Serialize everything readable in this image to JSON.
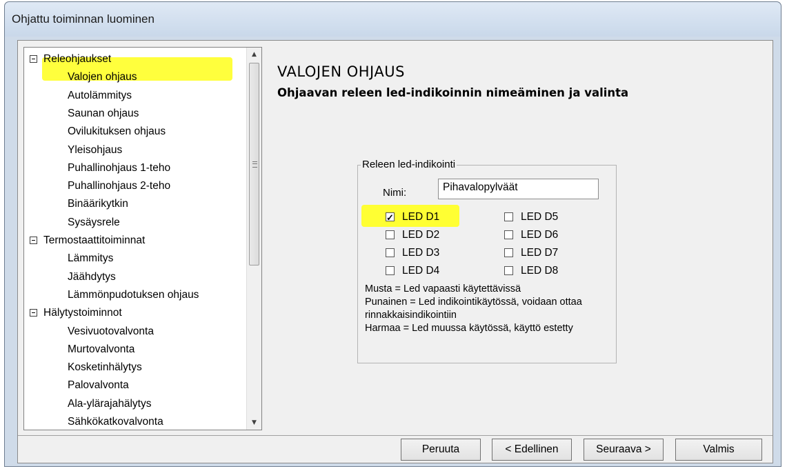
{
  "window": {
    "title": "Ohjattu toiminnan luominen"
  },
  "tree": {
    "items": [
      {
        "label": "Releohjaukset",
        "level": 0,
        "expanded": true
      },
      {
        "label": "Valojen ohjaus",
        "level": 1,
        "selected": true
      },
      {
        "label": "Autolämmitys",
        "level": 1
      },
      {
        "label": "Saunan ohjaus",
        "level": 1
      },
      {
        "label": "Ovilukituksen ohjaus",
        "level": 1
      },
      {
        "label": "Yleisohjaus",
        "level": 1
      },
      {
        "label": "Puhallinohjaus 1-teho",
        "level": 1
      },
      {
        "label": "Puhallinohjaus 2-teho",
        "level": 1
      },
      {
        "label": "Binäärikytkin",
        "level": 1
      },
      {
        "label": "Sysäysrele",
        "level": 1
      },
      {
        "label": "Termostaattitoiminnat",
        "level": 0,
        "expanded": true
      },
      {
        "label": "Lämmitys",
        "level": 1
      },
      {
        "label": "Jäähdytys",
        "level": 1
      },
      {
        "label": "Lämmönpudotuksen ohjaus",
        "level": 1
      },
      {
        "label": "Hälytystoiminnot",
        "level": 0,
        "expanded": true
      },
      {
        "label": "Vesivuotovalvonta",
        "level": 1
      },
      {
        "label": "Murtovalvonta",
        "level": 1
      },
      {
        "label": "Kosketinhälytys",
        "level": 1
      },
      {
        "label": "Palovalvonta",
        "level": 1
      },
      {
        "label": "Ala-ylärajahälytys",
        "level": 1
      },
      {
        "label": "Sähkökatkovalvonta",
        "level": 1
      }
    ]
  },
  "main": {
    "heading": "VALOJEN OHJAUS",
    "subheading": "Ohjaavan releen led-indikoinnin nimeäminen ja valinta",
    "group": {
      "title": "Releen led-indikointi",
      "name_label": "Nimi:",
      "name_value": "Pihavalopylväät",
      "leds": [
        {
          "label": "LED D1",
          "checked": true
        },
        {
          "label": "LED D2",
          "checked": false
        },
        {
          "label": "LED D3",
          "checked": false
        },
        {
          "label": "LED D4",
          "checked": false
        },
        {
          "label": "LED D5",
          "checked": false
        },
        {
          "label": "LED D6",
          "checked": false
        },
        {
          "label": "LED D7",
          "checked": false
        },
        {
          "label": "LED D8",
          "checked": false
        }
      ],
      "legend_lines": [
        "Musta = Led vapaasti käytettävissä",
        "Punainen = Led indikointikäytössä, voidaan ottaa",
        "rinnakkaisindikointiin",
        "Harmaa = Led muussa käytössä, käyttö estetty"
      ]
    }
  },
  "buttons": {
    "cancel": "Peruuta",
    "back": "< Edellinen",
    "next": "Seuraava >",
    "finish": "Valmis"
  },
  "colors": {
    "highlight": "#ffff33",
    "titlebar": "#cfdbe9"
  }
}
